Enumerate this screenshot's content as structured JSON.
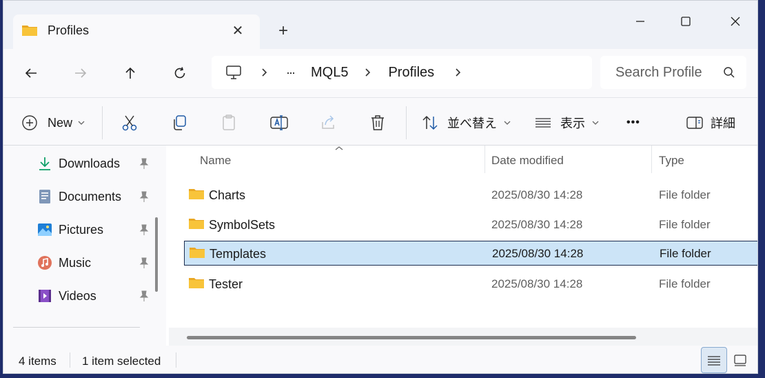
{
  "window": {
    "tab_title": "Profiles",
    "tab_close_glyph": "✕",
    "new_tab_glyph": "+"
  },
  "nav": {
    "breadcrumb": {
      "ellipsis": "···",
      "items": [
        "MQL5",
        "Profiles"
      ]
    },
    "search_placeholder": "Search Profile"
  },
  "command_bar": {
    "new_label": "New",
    "sort_label": "並べ替え",
    "view_label": "表示",
    "more_label": "•••",
    "details_label": "詳細"
  },
  "sidebar": {
    "items": [
      {
        "label": "Downloads",
        "icon": "download-icon"
      },
      {
        "label": "Documents",
        "icon": "documents-icon"
      },
      {
        "label": "Pictures",
        "icon": "pictures-icon"
      },
      {
        "label": "Music",
        "icon": "music-icon"
      },
      {
        "label": "Videos",
        "icon": "videos-icon"
      }
    ]
  },
  "file_list": {
    "columns": [
      "Name",
      "Date modified",
      "Type"
    ],
    "rows": [
      {
        "name": "Charts",
        "date": "2025/08/30 14:28",
        "type": "File folder",
        "selected": false
      },
      {
        "name": "SymbolSets",
        "date": "2025/08/30 14:28",
        "type": "File folder",
        "selected": false
      },
      {
        "name": "Templates",
        "date": "2025/08/30 14:28",
        "type": "File folder",
        "selected": true
      },
      {
        "name": "Tester",
        "date": "2025/08/30 14:28",
        "type": "File folder",
        "selected": false
      }
    ]
  },
  "status": {
    "item_count": "4 items",
    "selection": "1 item selected"
  },
  "colors": {
    "accent": "#0067c0",
    "selection_bg": "#cce4f7",
    "folder_yellow": "#f8c43a"
  }
}
